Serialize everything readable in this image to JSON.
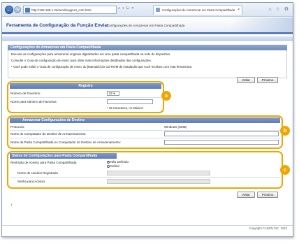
{
  "browser": {
    "url": "http://192.168.1.26/send/support_cmb.html",
    "tab_title": "Configurações de Armazenar em Pasta Compartilhada",
    "addr_controls": "⌕ ▾ ↻ ×",
    "toolbar_icons": "⌂ ☆ ⚙",
    "back_glyph": "←",
    "forward_glyph": "→",
    "tab_close_glyph": "×"
  },
  "app": {
    "title": "Ferramenta de Configuração da Função Enviar",
    "subtitle": "Configurações de Armazenar em Pasta Compartilhada"
  },
  "section": {
    "title": "Configurações do Armazenar em Pasta Compartilhada",
    "line1": "Execute as configurações para armazenar originais digitalizados em uma pasta compartilhada na rede do dispositivo.",
    "line2": "Consulte o 'Guia de configuração de envio' para obter mais informações detalhadas das configurações.",
    "line3": "* Você pode exibir o 'Guia de configuração de envio' do [Manuals] do CD-ROM de instalação que você recebeu com esta ferramenta."
  },
  "buttons": {
    "back": "Voltar",
    "next": "Próximo"
  },
  "registro": {
    "header": "Registro",
    "fav_number_label": "Número de Favoritos:",
    "fav_number_value": "02 ▾",
    "fav_name_label": "Nome para Número de Favoritos:",
    "fav_name_hint": "* 16 Caracteres, no Máximo"
  },
  "destino": {
    "header": "Armazenar Configurações de Destino",
    "protocol_label": "Protocolo:",
    "protocol_value": "Windows (SMB)",
    "computer_label": "Nome do Computador do Destino de Armazenamento:",
    "folder_label": "Nome da Pasta Compartilhada no Computador do Destino de Armazenamento:"
  },
  "status": {
    "header": "Status de Configurações para Pasta Compartilhada",
    "restriction_label": "Restrição de Acesso para Pasta Compartilhada",
    "opt_undefined": "Não Definido",
    "opt_define": "Definir",
    "user_label": "Nome de Usuário Registrado",
    "password_label": "Senha para Acesso:"
  },
  "badges": {
    "a": "a",
    "b": "b",
    "c": "c"
  },
  "footer": {
    "copyright": "Copyright CANON INC. 2015",
    "up_glyph": "↑"
  }
}
